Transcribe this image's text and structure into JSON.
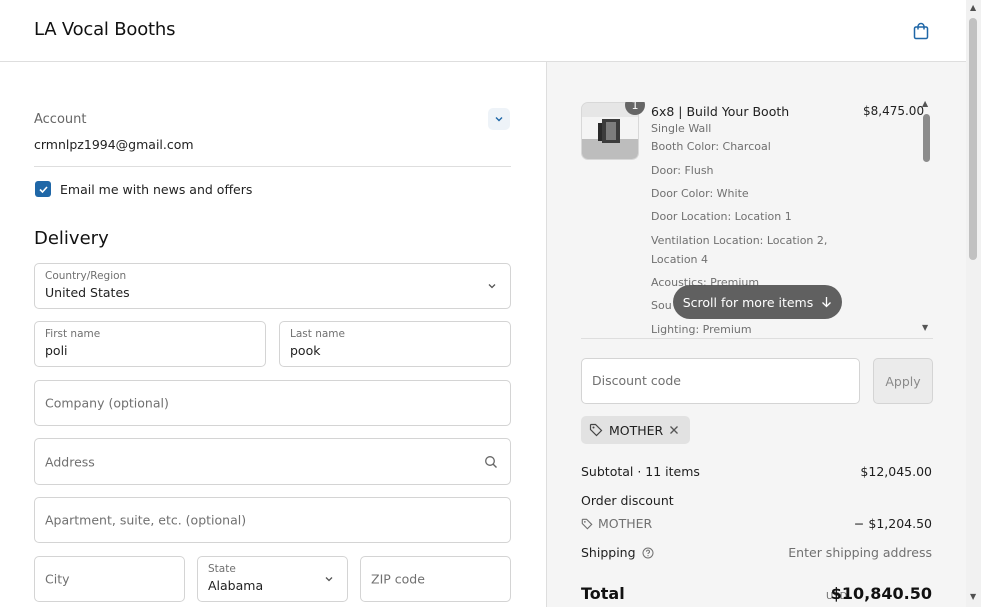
{
  "header": {
    "brand": "LA Vocal Booths"
  },
  "account": {
    "label": "Account",
    "email": "crmnlpz1994@gmail.com"
  },
  "newsletter": {
    "label": "Email me with news and offers",
    "checked": true
  },
  "delivery": {
    "title": "Delivery",
    "country": {
      "label": "Country/Region",
      "value": "United States"
    },
    "first_name": {
      "label": "First name",
      "value": "poli"
    },
    "last_name": {
      "label": "Last name",
      "value": "pook"
    },
    "company": {
      "placeholder": "Company (optional)"
    },
    "address": {
      "placeholder": "Address"
    },
    "apartment": {
      "placeholder": "Apartment, suite, etc. (optional)"
    },
    "city": {
      "placeholder": "City"
    },
    "state": {
      "label": "State",
      "value": "Alabama"
    },
    "zip": {
      "placeholder": "ZIP code"
    }
  },
  "cart": {
    "item": {
      "quantity": "1",
      "title": "6x8 | Build Your Booth",
      "price": "$8,475.00",
      "options": [
        "Single Wall",
        "Booth Color: Charcoal",
        "Door: Flush",
        "Door Color: White",
        "Door Location: Location 1",
        "Ventilation Location: Location 2, Location 4",
        "Acoustics: Premium",
        "Sou",
        "Lighting: Premium"
      ]
    },
    "scroll_hint": "Scroll for more items"
  },
  "discount": {
    "placeholder": "Discount code",
    "apply_label": "Apply",
    "applied_code": "MOTHER"
  },
  "summary": {
    "subtotal_label": "Subtotal · 11 items",
    "subtotal_value": "$12,045.00",
    "order_discount_label": "Order discount",
    "discount_code": "MOTHER",
    "discount_value": "− $1,204.50",
    "shipping_label": "Shipping",
    "shipping_value": "Enter shipping address",
    "total_label": "Total",
    "total_currency": "USD",
    "total_value": "$10,840.50"
  },
  "colors": {
    "accent": "#1f67a7",
    "summary_bg": "#f5f5f5",
    "border": "#d4d4d4"
  }
}
